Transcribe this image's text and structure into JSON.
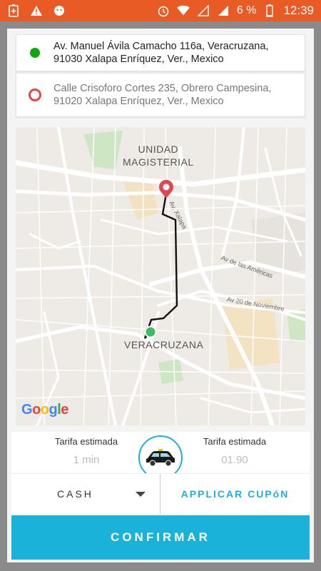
{
  "status_bar": {
    "battery_percent": "6 %",
    "time": "12:39",
    "icons": [
      "battery-plus-icon",
      "warning-icon",
      "cat-icon",
      "alarm-icon",
      "wifi-icon",
      "no-sim-icon",
      "signal-icon",
      "battery-icon"
    ]
  },
  "pickup": {
    "address": "Av. Manuel Ávila Camacho 116a, Veracruzana, 91030 Xalapa Enríquez, Ver., Mexico",
    "line1": "Av. Manuel Ávila Camacho 116a, Veracruzana,",
    "line2": "91030 Xalapa Enríquez, Ver., Mexico",
    "marker_color": "#11a611"
  },
  "destination": {
    "address": "Calle Crisoforo Cortes 235, Obrero Campesina, 91020 Xalapa Enríquez, Ver., Mexico",
    "line1": "Calle Crisoforo Cortes 235, Obrero Campesina,",
    "line2": "91020 Xalapa Enríquez, Ver., Mexico",
    "marker_color": "#e0474c"
  },
  "map": {
    "label_unidad_1": "UNIDAD",
    "label_unidad_2": "MAGISTERIAL",
    "label_veracruzana": "VERACRUZANA",
    "street_xalapa": "Av. Xalapa",
    "street_americas": "Av de las Américas",
    "street_noviembre": "Av 20 de Noviembre",
    "logo": {
      "g": "G",
      "o1": "o",
      "o2": "o",
      "g2": "g",
      "l": "l",
      "e": "e"
    }
  },
  "fare": {
    "left_title": "Tarifa estimada",
    "left_value": "1 min",
    "right_title": "Tarifa estimada",
    "right_value": "01.90"
  },
  "payment": {
    "selected": "CASH",
    "coupon_label": "APPLICAR CUPóN"
  },
  "confirm_label": "CONFIRMAR",
  "colors": {
    "accent": "#1ab2d9",
    "status_bar": "#e85b25"
  }
}
